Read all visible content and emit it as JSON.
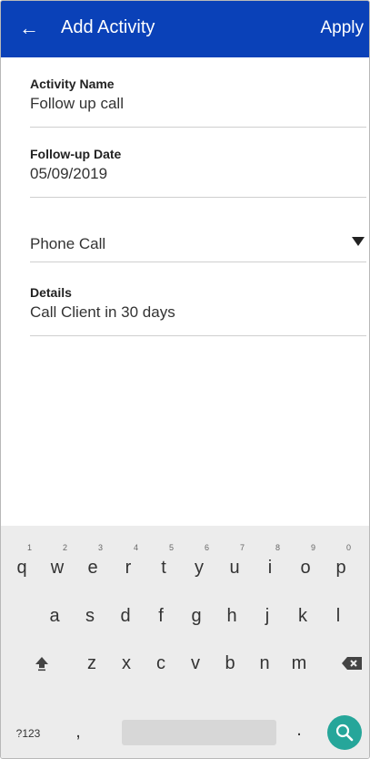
{
  "appbar": {
    "back_icon": "arrow-left-icon",
    "title": "Add Activity",
    "apply_label": "Apply",
    "color": "#0a41b8"
  },
  "form": {
    "activity_name": {
      "label": "Activity Name",
      "value": "Follow up call"
    },
    "follow_up_date": {
      "label": "Follow-up Date",
      "value": "05/09/2019"
    },
    "activity_type": {
      "value": "Phone Call",
      "icon": "dropdown-caret-icon"
    },
    "details": {
      "label": "Details",
      "value": "Call Client in 30 days"
    }
  },
  "keyboard": {
    "row1": [
      {
        "key": "q",
        "hint": "1"
      },
      {
        "key": "w",
        "hint": "2"
      },
      {
        "key": "e",
        "hint": "3"
      },
      {
        "key": "r",
        "hint": "4"
      },
      {
        "key": "t",
        "hint": "5"
      },
      {
        "key": "y",
        "hint": "6"
      },
      {
        "key": "u",
        "hint": "7"
      },
      {
        "key": "i",
        "hint": "8"
      },
      {
        "key": "o",
        "hint": "9"
      },
      {
        "key": "p",
        "hint": "0"
      }
    ],
    "row2": [
      "a",
      "s",
      "d",
      "f",
      "g",
      "h",
      "j",
      "k",
      "l"
    ],
    "row3": [
      "z",
      "x",
      "c",
      "v",
      "b",
      "n",
      "m"
    ],
    "shift_icon": "shift-icon",
    "backspace_icon": "backspace-icon",
    "symbols_label": "?123",
    "comma": ",",
    "period": ".",
    "search_icon": "search-icon",
    "accent": "#26a69a"
  }
}
